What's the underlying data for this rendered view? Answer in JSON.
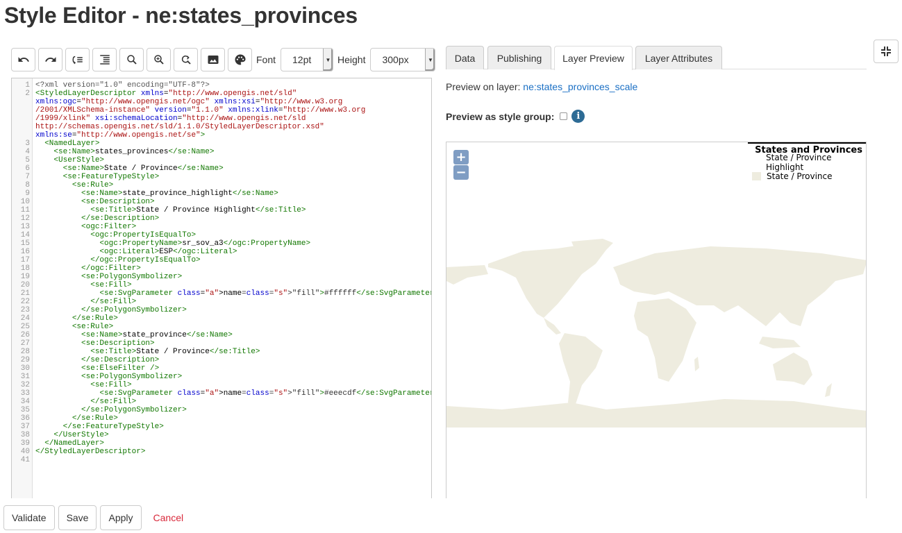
{
  "page": {
    "title": "Style Editor - ne:states_provinces"
  },
  "toolbar": {
    "buttons": [
      {
        "name": "undo",
        "icon": "undo-icon"
      },
      {
        "name": "redo",
        "icon": "redo-icon"
      },
      {
        "name": "go-to-line",
        "icon": "go-to-line-icon"
      },
      {
        "name": "reformat",
        "icon": "indent-icon"
      },
      {
        "name": "find",
        "icon": "search-icon"
      },
      {
        "name": "find-next",
        "icon": "search-plus-icon"
      },
      {
        "name": "replace",
        "icon": "replace-icon"
      },
      {
        "name": "legend-graphic",
        "icon": "image-icon"
      },
      {
        "name": "color-picker",
        "icon": "palette-icon"
      }
    ],
    "font_label": "Font",
    "font_value": "12pt",
    "height_label": "Height",
    "height_value": "300px"
  },
  "editor": {
    "line_numbers": [
      "1",
      "2",
      "",
      "",
      "",
      "",
      "",
      "3",
      "4",
      "5",
      "6",
      "7",
      "8",
      "9",
      "10",
      "11",
      "12",
      "13",
      "14",
      "15",
      "16",
      "17",
      "18",
      "19",
      "20",
      "21",
      "22",
      "23",
      "24",
      "25",
      "26",
      "27",
      "28",
      "29",
      "30",
      "31",
      "32",
      "33",
      "34",
      "35",
      "36",
      "37",
      "38",
      "39",
      "40",
      "41"
    ],
    "lines": [
      "<?xml version=\"1.0\" encoding=\"UTF-8\"?>",
      "<StyledLayerDescriptor xmlns=\"http://www.opengis.net/sld\" xmlns:ogc=\"http://www.opengis.net/ogc\" xmlns:xsi=\"http://www.w3.org/2001/XMLSchema-instance\" version=\"1.1.0\" xmlns:xlink=\"http://www.w3.org/1999/xlink\" xsi:schemaLocation=\"http://www.opengis.net/sld http://schemas.opengis.net/sld/1.1.0/StyledLayerDescriptor.xsd\" xmlns:se=\"http://www.opengis.net/se\">",
      "  <NamedLayer>",
      "    <se:Name>states_provinces</se:Name>",
      "    <UserStyle>",
      "      <se:Name>State / Province</se:Name>",
      "      <se:FeatureTypeStyle>",
      "        <se:Rule>",
      "          <se:Name>state_province_highlight</se:Name>",
      "          <se:Description>",
      "            <se:Title>State / Province Highlight</se:Title>",
      "          </se:Description>",
      "          <ogc:Filter>",
      "            <ogc:PropertyIsEqualTo>",
      "              <ogc:PropertyName>sr_sov_a3</ogc:PropertyName>",
      "              <ogc:Literal>ESP</ogc:Literal>",
      "            </ogc:PropertyIsEqualTo>",
      "          </ogc:Filter>",
      "          <se:PolygonSymbolizer>",
      "            <se:Fill>",
      "              <se:SvgParameter name=\"fill\">#ffffff</se:SvgParameter>",
      "            </se:Fill>",
      "          </se:PolygonSymbolizer>",
      "        </se:Rule>",
      "        <se:Rule>",
      "          <se:Name>state_province</se:Name>",
      "          <se:Description>",
      "            <se:Title>State / Province</se:Title>",
      "          </se:Description>",
      "          <se:ElseFilter />",
      "          <se:PolygonSymbolizer>",
      "            <se:Fill>",
      "              <se:SvgParameter name=\"fill\">#eeecdf</se:SvgParameter>",
      "            </se:Fill>",
      "          </se:PolygonSymbolizer>",
      "        </se:Rule>",
      "      </se:FeatureTypeStyle>",
      "    </UserStyle>",
      "  </NamedLayer>",
      "</StyledLayerDescriptor>",
      ""
    ],
    "line2_wrapped": [
      "<StyledLayerDescriptor xmlns=\"http://www.opengis.net/sld\"",
      "xmlns:ogc=\"http://www.opengis.net/ogc\" xmlns:xsi=\"http://www.w3.org",
      "/2001/XMLSchema-instance\" version=\"1.1.0\" xmlns:xlink=\"http://www.w3.org",
      "/1999/xlink\" xsi:schemaLocation=\"http://www.opengis.net/sld",
      "http://schemas.opengis.net/sld/1.1.0/StyledLayerDescriptor.xsd\"",
      "xmlns:se=\"http://www.opengis.net/se\">"
    ]
  },
  "tabs": [
    {
      "label": "Data",
      "active": false
    },
    {
      "label": "Publishing",
      "active": false
    },
    {
      "label": "Layer Preview",
      "active": true
    },
    {
      "label": "Layer Attributes",
      "active": false
    }
  ],
  "preview": {
    "layer_label": "Preview on layer:",
    "layer_link": "ne:states_provinces_scale",
    "group_label": "Preview as style group:",
    "group_checked": false,
    "info_icon": "i"
  },
  "map": {
    "zoom_in": "+",
    "zoom_out": "−",
    "land_color": "#eeecdf",
    "legend": {
      "title": "States and Provinces",
      "items": [
        {
          "label": "State / Province Highlight",
          "color": "#ffffff"
        },
        {
          "label": "State / Province",
          "color": "#eeecdf"
        }
      ]
    }
  },
  "actions": {
    "validate": "Validate",
    "save": "Save",
    "apply": "Apply",
    "cancel": "Cancel"
  }
}
